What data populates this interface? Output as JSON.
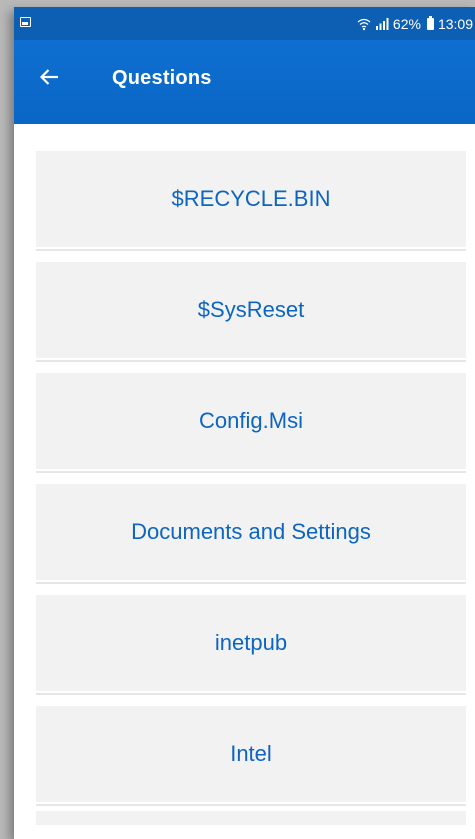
{
  "statusbar": {
    "battery": "62%",
    "time": "13:09",
    "icons": [
      "gallery-icon",
      "wifi-icon",
      "signal-icon",
      "battery-icon"
    ]
  },
  "appbar": {
    "title": "Questions",
    "back_icon": "arrow-left-icon"
  },
  "list": {
    "items": [
      {
        "label": "$RECYCLE.BIN"
      },
      {
        "label": "$SysReset"
      },
      {
        "label": "Config.Msi"
      },
      {
        "label": "Documents and Settings"
      },
      {
        "label": "inetpub"
      },
      {
        "label": "Intel"
      }
    ]
  },
  "colors": {
    "statusbar": "#0d5fb3",
    "appbar": "#0d6dcd",
    "item_bg": "#f2f2f2",
    "item_text": "#0d65c0",
    "background": "#ffffff"
  }
}
